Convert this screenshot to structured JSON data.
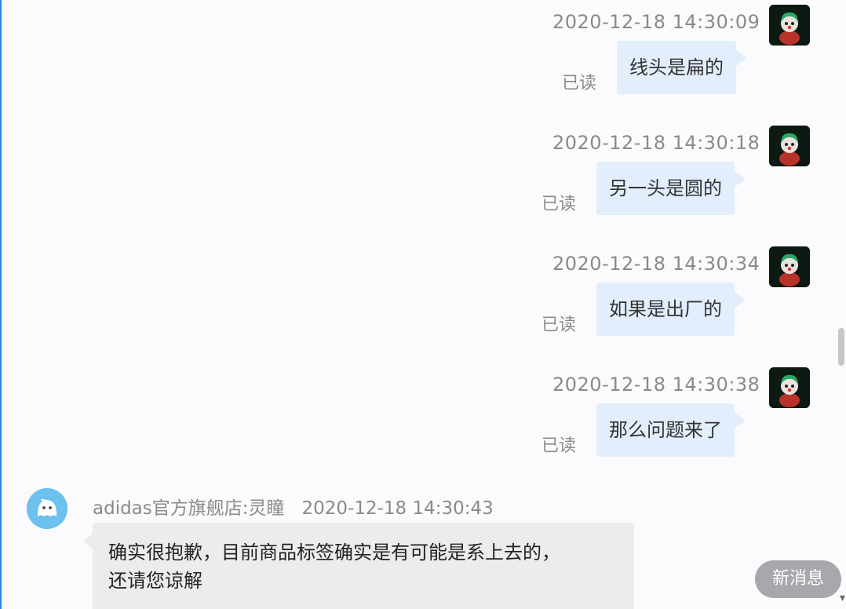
{
  "outgoing": [
    {
      "timestamp": "2020-12-18 14:30:09",
      "text": "线头是扁的",
      "status": "已读"
    },
    {
      "timestamp": "2020-12-18 14:30:18",
      "text": "另一头是圆的",
      "status": "已读"
    },
    {
      "timestamp": "2020-12-18 14:30:34",
      "text": "如果是出厂的",
      "status": "已读"
    },
    {
      "timestamp": "2020-12-18 14:30:38",
      "text": "那么问题来了",
      "status": "已读"
    }
  ],
  "incoming": {
    "sender": "adidas官方旗舰店:灵瞳",
    "timestamp": "2020-12-18 14:30:43",
    "text": "确实很抱歉，目前商品标签确实是有可能是系上去的，还请您谅解"
  },
  "new_message_button": "新消息",
  "colors": {
    "outgoing_bubble": "#e2eefc",
    "incoming_bubble": "#ececef",
    "timestamp_text": "#8a8a8a",
    "new_message_bg": "#a8a8ac",
    "window_edge": "#2a86d6"
  },
  "icons": {
    "user_avatar": "clown-figure-avatar",
    "shop_avatar": "cartoon-ghost-avatar",
    "scroll_down": "chevron-down-icon"
  }
}
